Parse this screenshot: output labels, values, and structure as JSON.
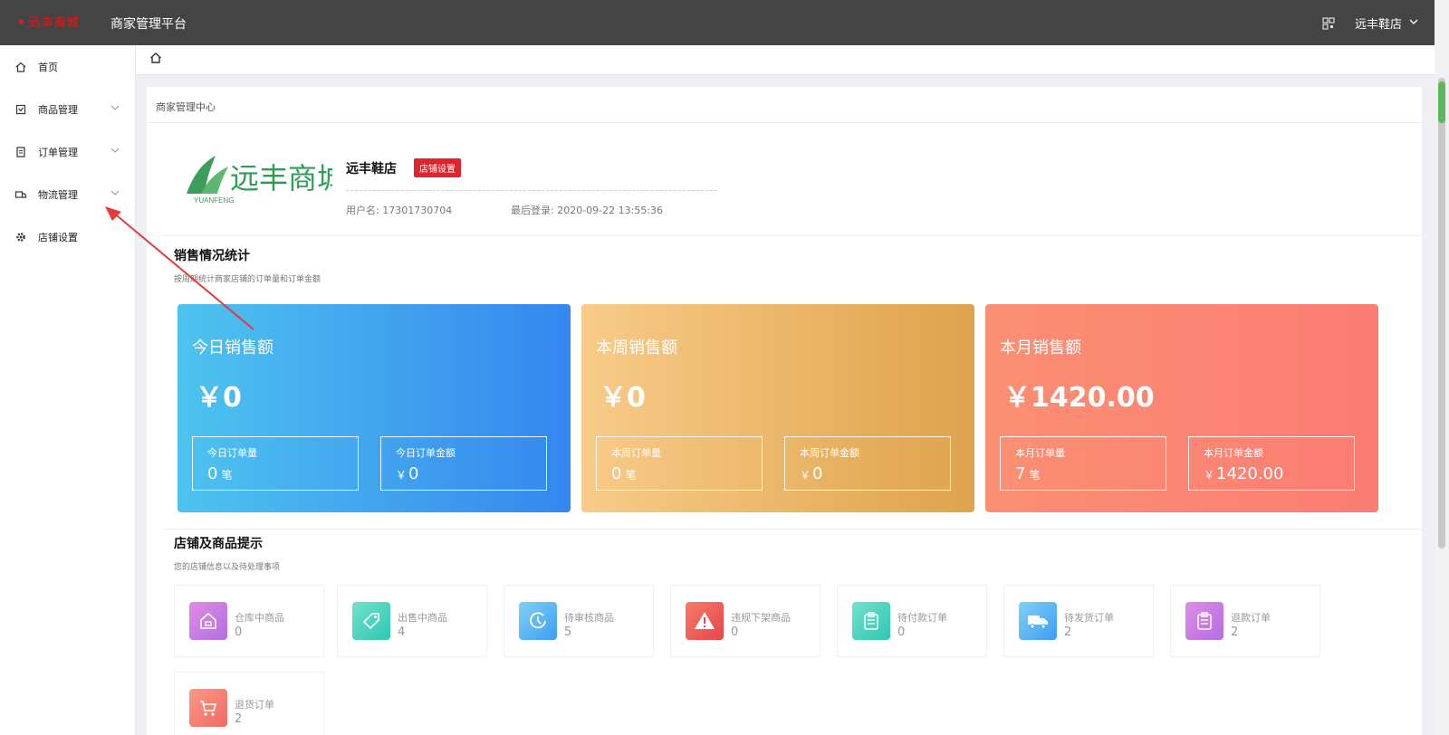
{
  "topbar": {
    "brand_text": "远丰商城",
    "platform_title": "商家管理平台",
    "user_menu": "远丰鞋店"
  },
  "sidebar": {
    "items": [
      {
        "label": "首页",
        "icon": "home-icon"
      },
      {
        "label": "商品管理",
        "icon": "goods-icon"
      },
      {
        "label": "订单管理",
        "icon": "order-icon"
      },
      {
        "label": "物流管理",
        "icon": "logistics-icon"
      },
      {
        "label": "店铺设置",
        "icon": "gear-icon"
      }
    ]
  },
  "panel": {
    "title": "商家管理中心"
  },
  "profile": {
    "logo_text": "远丰商城",
    "logo_sub": "YUANFENG",
    "shop_name": "远丰鞋店",
    "shop_setting": "店铺设置",
    "username": "用户名: 17301730704",
    "last_login": "最后登录: 2020-09-22 13:55:36"
  },
  "sales": {
    "title": "销售情况统计",
    "subtitle": "按周期统计商家店铺的订单量和订单金额",
    "cards": [
      {
        "title": "今日销售额",
        "amount": "￥0",
        "orders_label": "今日订单量",
        "orders_value": "0",
        "orders_unit": "笔",
        "money_label": "今日订单金额",
        "money_value": "0",
        "money_prefix": "￥"
      },
      {
        "title": "本周销售额",
        "amount": "￥0",
        "orders_label": "本周订单量",
        "orders_value": "0",
        "orders_unit": "笔",
        "money_label": "本周订单金额",
        "money_value": "0",
        "money_prefix": "￥"
      },
      {
        "title": "本月销售额",
        "amount": "￥1420.00",
        "orders_label": "本月订单量",
        "orders_value": "7",
        "orders_unit": "笔",
        "money_label": "本月订单金额",
        "money_value": "1420.00",
        "money_prefix": "￥"
      }
    ]
  },
  "tips": {
    "title": "店铺及商品提示",
    "subtitle": "您的店铺信息以及待处理事项",
    "items": [
      {
        "label": "仓库中商品",
        "value": "0",
        "icon": "warehouse-icon"
      },
      {
        "label": "出售中商品",
        "value": "4",
        "icon": "sale-tag-icon"
      },
      {
        "label": "待审核商品",
        "value": "5",
        "icon": "clock-icon"
      },
      {
        "label": "违规下架商品",
        "value": "0",
        "icon": "warning-icon"
      },
      {
        "label": "待付款订单",
        "value": "0",
        "icon": "clipboard-icon"
      },
      {
        "label": "待发货订单",
        "value": "2",
        "icon": "truck-icon"
      },
      {
        "label": "退款订单",
        "value": "2",
        "icon": "clipboard-icon"
      },
      {
        "label": "退货订单",
        "value": "2",
        "icon": "cart-icon"
      }
    ]
  }
}
